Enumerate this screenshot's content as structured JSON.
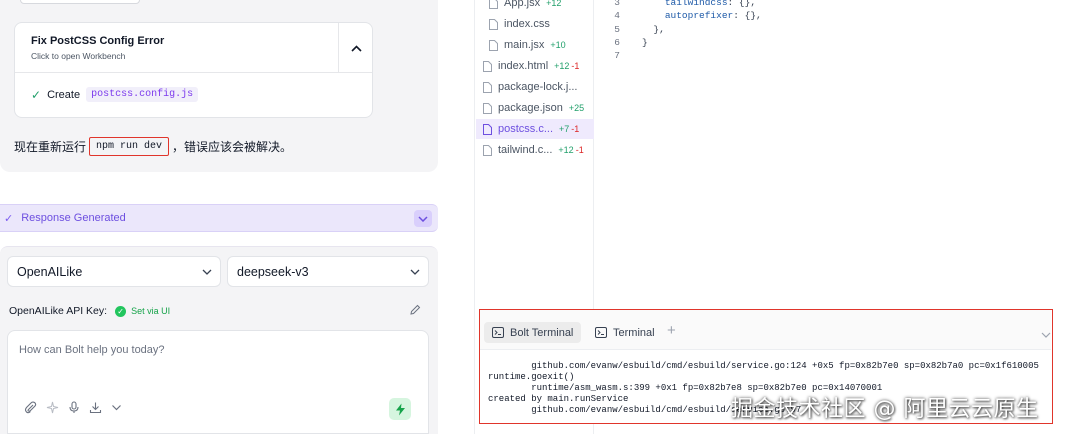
{
  "chat": {
    "artifact": {
      "title": "Fix PostCSS Config Error",
      "subtitle": "Click to open Workbench",
      "action_verb": "Create",
      "action_file": "postcss.config.js"
    },
    "message": {
      "before": "现在重新运行",
      "command": "npm run dev",
      "after": "，错误应该会被解决。"
    },
    "response_status": "Response Generated",
    "provider_select": "OpenAILike",
    "model_select": "deepseek-v3",
    "api_key_label": "OpenAILike API Key:",
    "api_key_status": "Set via UI",
    "prompt_placeholder": "How can Bolt help you today?"
  },
  "file_tree": [
    {
      "name": "App.jsx",
      "added": "+12",
      "removed": "",
      "active": false,
      "indent": true
    },
    {
      "name": "index.css",
      "added": "",
      "removed": "",
      "active": false,
      "indent": true
    },
    {
      "name": "main.jsx",
      "added": "+10",
      "removed": "",
      "active": false,
      "indent": true
    },
    {
      "name": "index.html",
      "added": "+12",
      "removed": "-1",
      "active": false,
      "indent": false
    },
    {
      "name": "package-lock.j...",
      "added": "",
      "removed": "",
      "active": false,
      "indent": false
    },
    {
      "name": "package.json",
      "added": "+25",
      "removed": "",
      "active": false,
      "indent": false
    },
    {
      "name": "postcss.c...",
      "added": "+7",
      "removed": "-1",
      "active": true,
      "indent": false
    },
    {
      "name": "tailwind.c...",
      "added": "+12",
      "removed": "-1",
      "active": false,
      "indent": false
    }
  ],
  "editor": {
    "lines": [
      {
        "num": "3",
        "indent": "    ",
        "key": "tailwindcss",
        "rest": ": {},"
      },
      {
        "num": "4",
        "indent": "    ",
        "key": "autoprefixer",
        "rest": ": {},"
      },
      {
        "num": "5",
        "indent": "  ",
        "key": "",
        "rest": "},"
      },
      {
        "num": "6",
        "indent": "",
        "key": "",
        "rest": "}"
      },
      {
        "num": "7",
        "indent": "",
        "key": "",
        "rest": ""
      }
    ]
  },
  "terminal": {
    "tabs": [
      "Bolt Terminal",
      "Terminal"
    ],
    "output": [
      "        github.com/evanw/esbuild/cmd/esbuild/service.go:124 +0x5 fp=0x82b7e0 sp=0x82b7a0 pc=0x1f610005",
      "runtime.goexit()",
      "        runtime/asm_wasm.s:399 +0x1 fp=0x82b7e8 sp=0x82b7e0 pc=0x14070001",
      "created by main.runService",
      "        github.com/evanw/esbuild/cmd/esbuild/service.go:97"
    ]
  },
  "watermark": "掘金技术社区 @ 阿里云云原生",
  "colors": {
    "accent": "#7c5cf0",
    "diff_added": "#22a06b",
    "diff_removed": "#dc2626",
    "highlight_border": "#e0352b"
  }
}
